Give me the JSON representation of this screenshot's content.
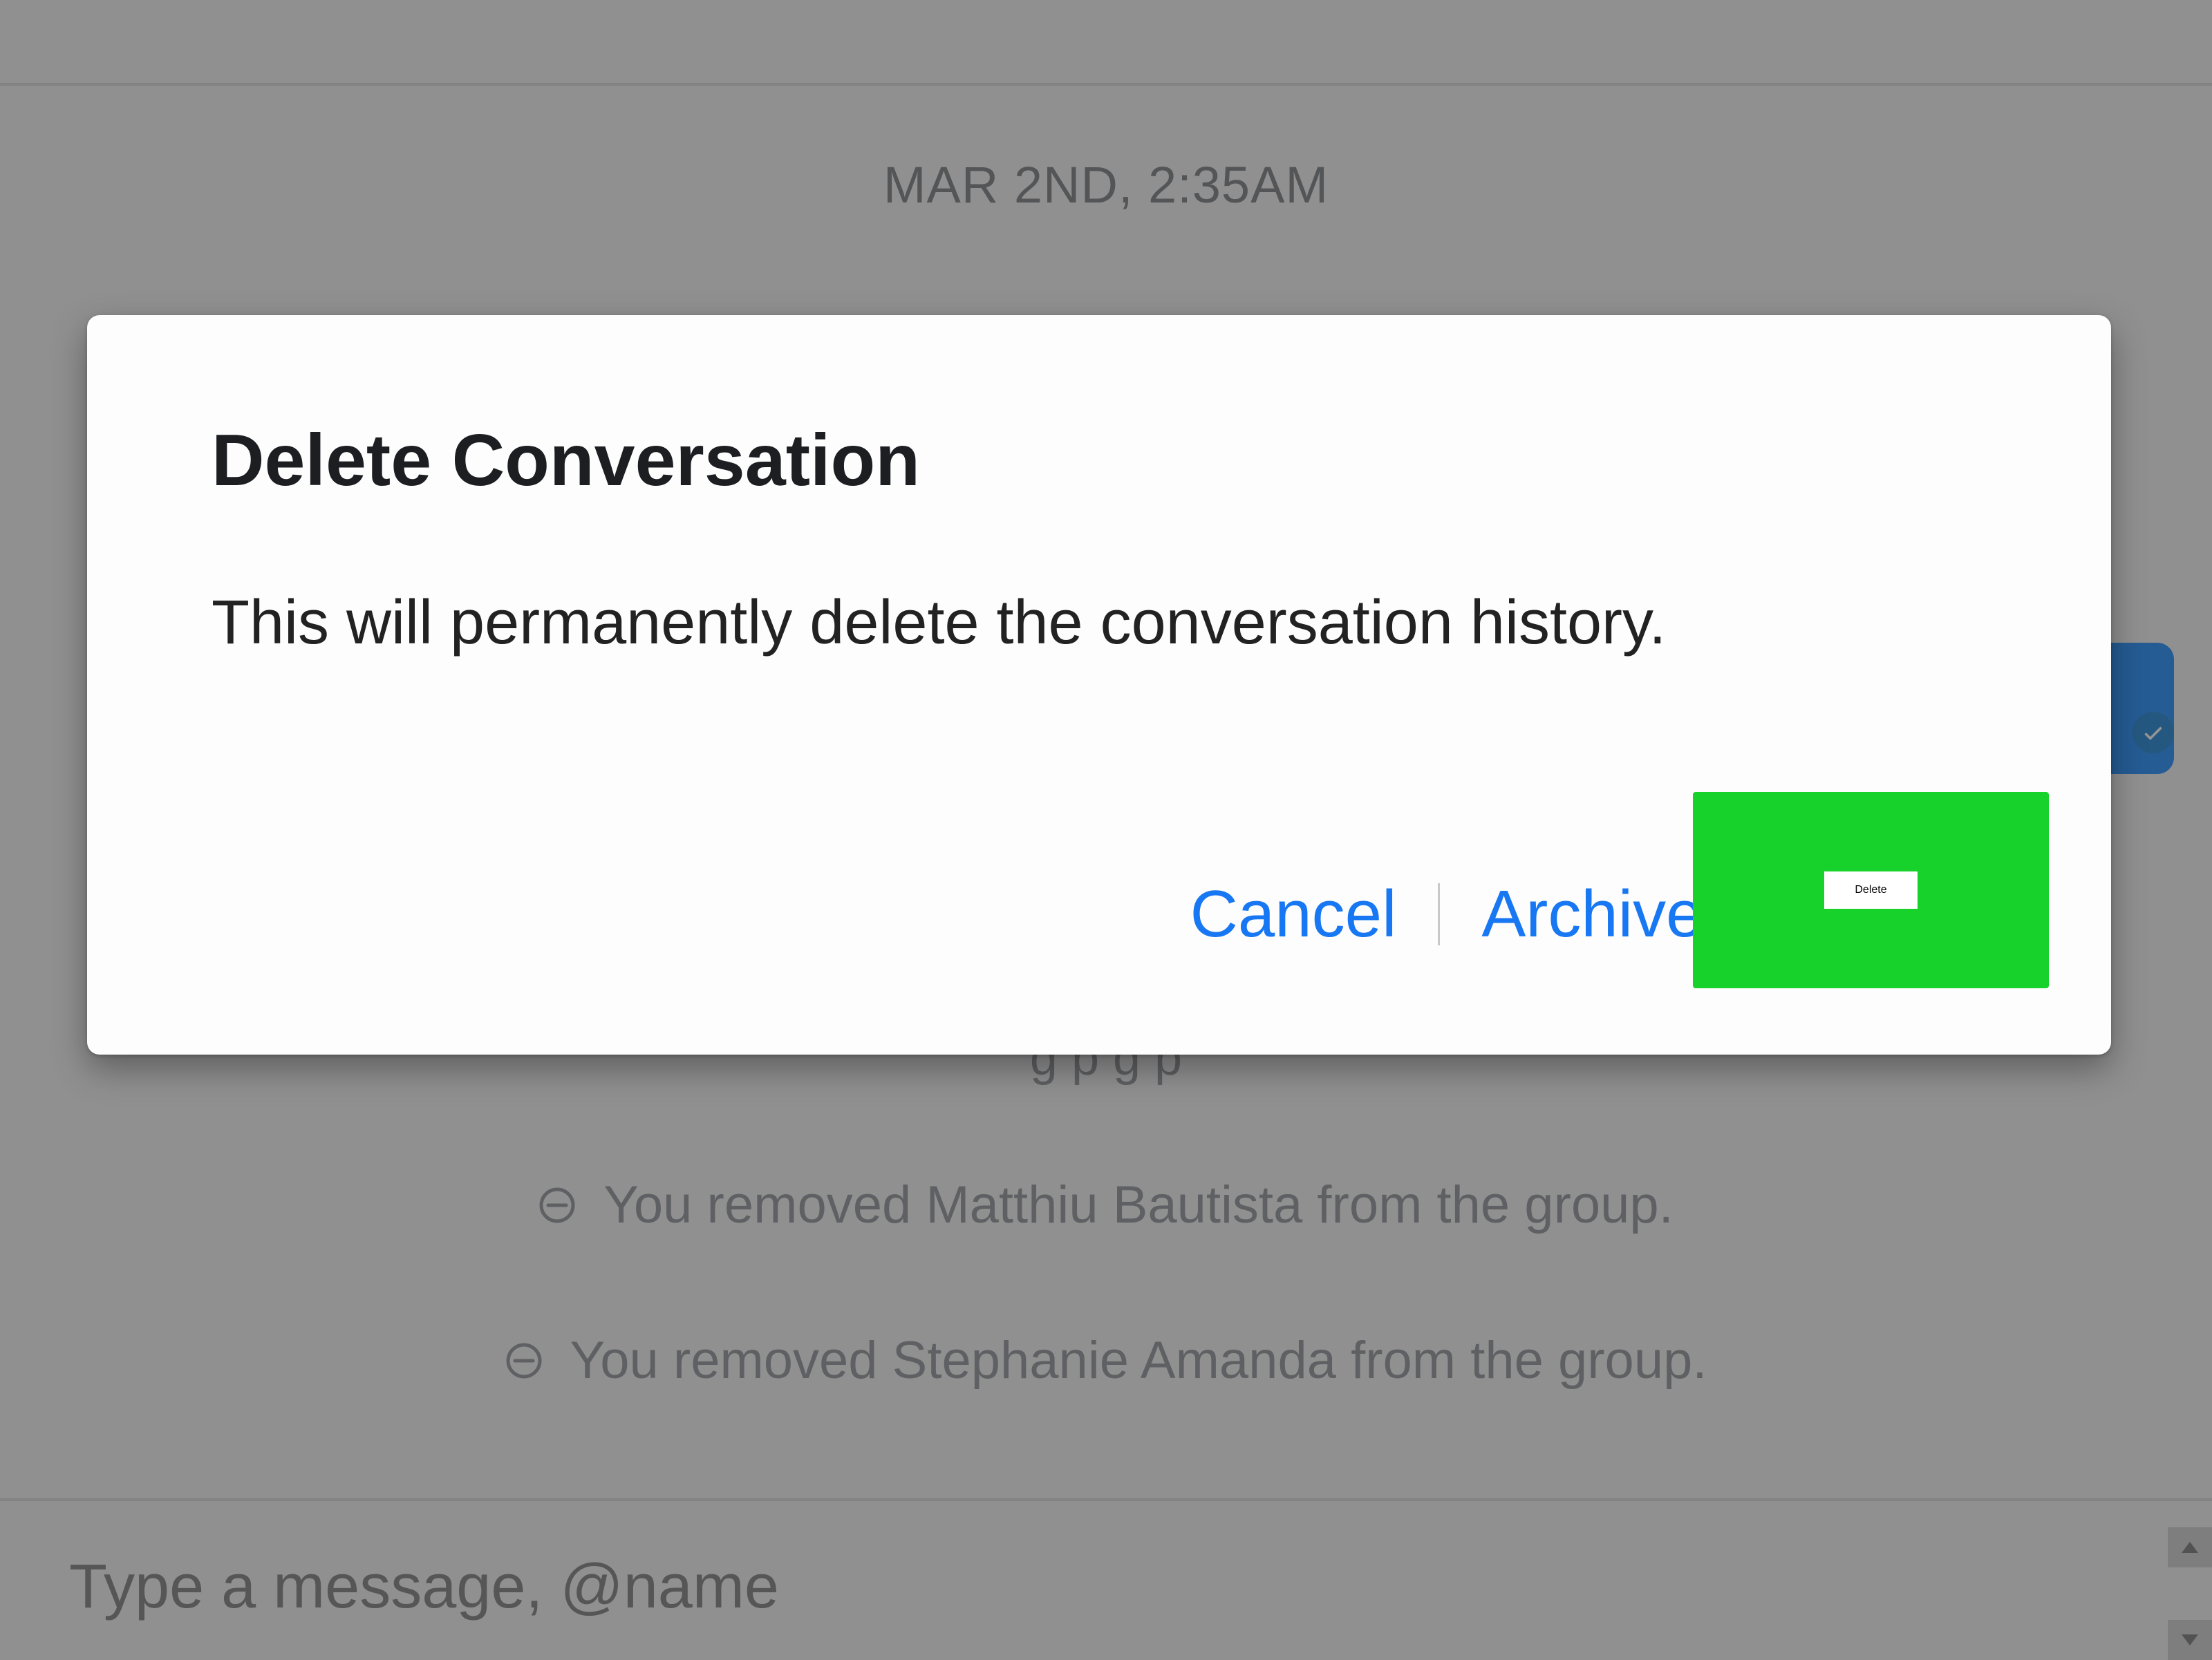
{
  "chat": {
    "timestamp": "MAR 2ND, 2:35AM",
    "partial_system_row": "g                                             p                              g      p",
    "system_rows": [
      "You removed Matthiu Bautista from the group.",
      "You removed Stephanie Amanda from the group."
    ],
    "input_placeholder": "Type a message, @name"
  },
  "dialog": {
    "title": "Delete Conversation",
    "body": "This will permanently delete the conversation history.",
    "cancel_label": "Cancel",
    "archive_label": "Archive",
    "delete_label": "Delete"
  }
}
